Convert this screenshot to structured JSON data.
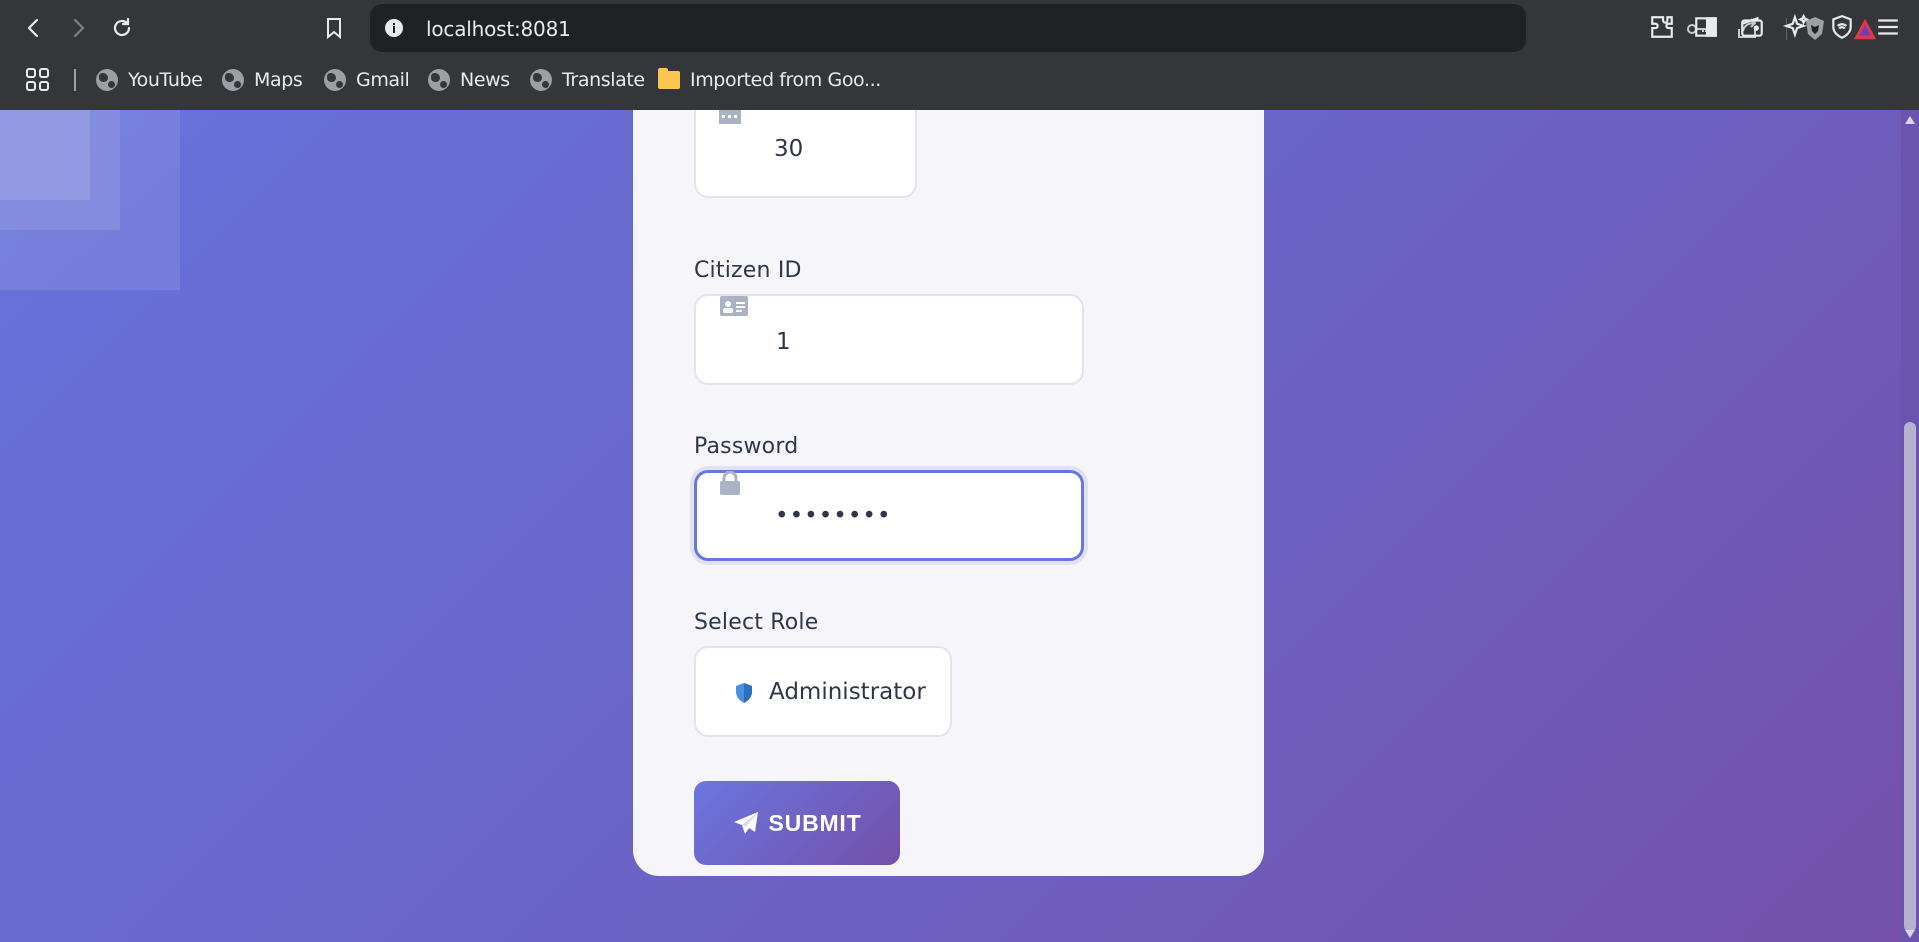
{
  "browser": {
    "url": "localhost:8081",
    "bookmarks": [
      {
        "label": "YouTube",
        "icon": "globe-icon"
      },
      {
        "label": "Maps",
        "icon": "globe-icon"
      },
      {
        "label": "Gmail",
        "icon": "globe-icon"
      },
      {
        "label": "News",
        "icon": "globe-icon"
      },
      {
        "label": "Translate",
        "icon": "globe-icon"
      },
      {
        "label": "Imported from Goo...",
        "icon": "folder-icon"
      }
    ]
  },
  "form": {
    "age": {
      "value": "30",
      "icon": "calendar-icon"
    },
    "citizen_id": {
      "label": "Citizen ID",
      "value": "1",
      "icon": "id-card-icon"
    },
    "password": {
      "label": "Password",
      "value": "••••••••",
      "icon": "lock-icon"
    },
    "role": {
      "label": "Select Role",
      "value": "Administrator",
      "icon": "shield-icon"
    },
    "submit_label": "SUBMIT"
  },
  "colors": {
    "accent": "#6679d9",
    "gradient_start": "#6673dc",
    "gradient_end": "#7450ab",
    "card_bg": "#f6f5fa"
  }
}
